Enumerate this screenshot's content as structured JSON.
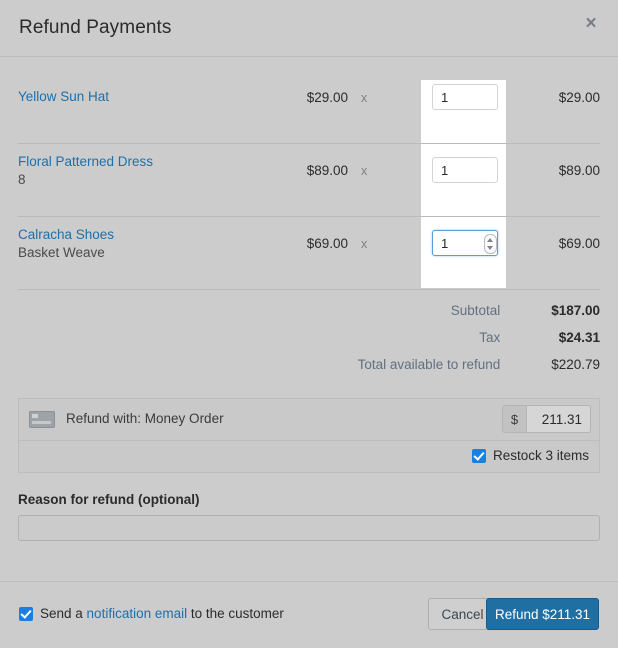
{
  "header": {
    "title": "Refund Payments",
    "close_label": "×"
  },
  "items": [
    {
      "title": "Yellow Sun Hat",
      "variant": "",
      "price": "$29.00",
      "multiplier": "x",
      "qty": "1",
      "total": "$29.00"
    },
    {
      "title": "Floral Patterned Dress",
      "variant": "8",
      "price": "$89.00",
      "multiplier": "x",
      "qty": "1",
      "total": "$89.00"
    },
    {
      "title": "Calracha Shoes",
      "variant": "Basket Weave",
      "price": "$69.00",
      "multiplier": "x",
      "qty": "1",
      "total": "$69.00"
    }
  ],
  "totals": [
    {
      "label": "Subtotal",
      "value": "$187.00"
    },
    {
      "label": "Tax",
      "value": "$24.31"
    },
    {
      "label": "Total available to refund",
      "value": "$220.79"
    }
  ],
  "refund_box": {
    "method_label": "Refund with: Money Order",
    "currency_symbol": "$",
    "amount": "211.31",
    "restock_label": "Restock 3 items"
  },
  "reason": {
    "label": "Reason for refund (optional)",
    "value": "",
    "placeholder": ""
  },
  "footer": {
    "notify_prefix": "Send a ",
    "notify_link": "notification email",
    "notify_suffix": " to the customer",
    "cancel_label": "Cancel",
    "refund_label": "Refund $211.31"
  },
  "colors": {
    "background": "#cccccc",
    "link": "#1f6fa8",
    "primary_button": "#1f6fa3",
    "checkbox": "#1a7fe0",
    "focus_border": "#5b9dd9"
  }
}
